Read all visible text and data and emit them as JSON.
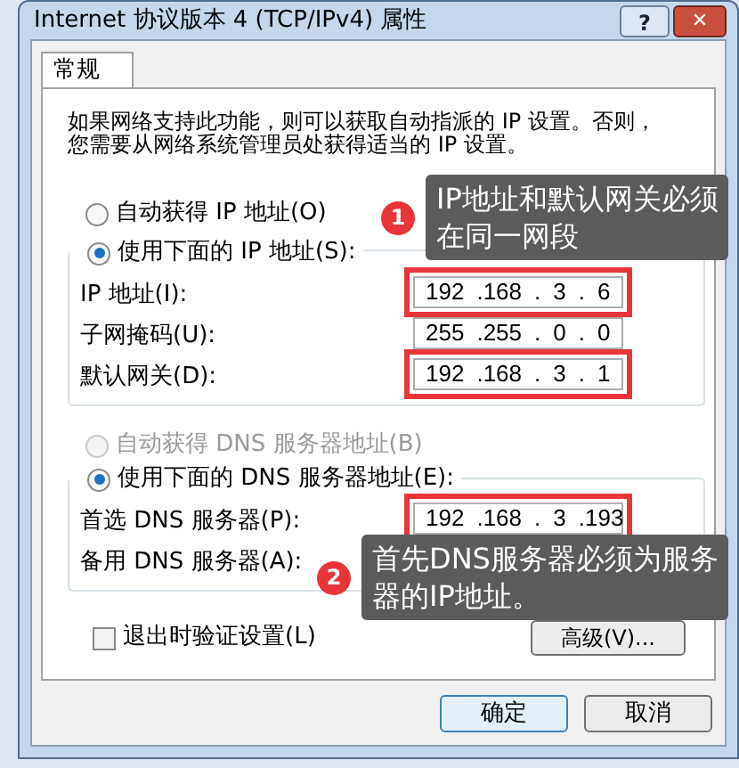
{
  "window": {
    "title": "Internet 协议版本 4 (TCP/IPv4) 属性",
    "help_button": "?",
    "close_button": "✕"
  },
  "tabs": [
    {
      "label": "常规",
      "selected": true
    }
  ],
  "intro": [
    "如果网络支持此功能，则可以获取自动指派的 IP 设置。否则，",
    "您需要从网络系统管理员处获得适当的 IP 设置。"
  ],
  "ip_section": {
    "options": [
      {
        "label": "自动获得 IP 地址(O)",
        "selected": false,
        "disabled": false
      },
      {
        "label": "使用下面的 IP 地址(S):",
        "selected": true,
        "disabled": false
      }
    ],
    "fields": [
      {
        "label": "IP 地址(I):",
        "octets": [
          "192",
          ".168",
          ".",
          "3",
          ".",
          "6"
        ],
        "highlighted": true
      },
      {
        "label": "子网掩码(U):",
        "octets": [
          "255",
          ".255",
          ".",
          "0",
          ".",
          "0"
        ],
        "highlighted": false
      },
      {
        "label": "默认网关(D):",
        "octets": [
          "192",
          ".168",
          ".",
          "3",
          ".",
          "1"
        ],
        "highlighted": true
      }
    ]
  },
  "dns_section": {
    "options": [
      {
        "label": "自动获得 DNS 服务器地址(B)",
        "selected": false,
        "disabled": true
      },
      {
        "label": "使用下面的 DNS 服务器地址(E):",
        "selected": true,
        "disabled": false
      }
    ],
    "fields": [
      {
        "label": "首选 DNS 服务器(P):",
        "octets": [
          "192",
          ".168",
          ".",
          "3",
          ".193"
        ],
        "highlighted": true
      },
      {
        "label": "备用 DNS 服务器(A):"
      }
    ]
  },
  "validate_checkbox": {
    "label": "退出时验证设置(L)",
    "checked": false
  },
  "advanced_button": "高级(V)...",
  "buttons": [
    "确定",
    "取消"
  ],
  "callouts": [
    {
      "number": "1",
      "lines": [
        "IP地址和默认网关必须",
        "在同一网段"
      ]
    },
    {
      "number": "2",
      "lines": [
        "首先DNS服务器必须为服务",
        "器的IP地址。"
      ]
    }
  ]
}
